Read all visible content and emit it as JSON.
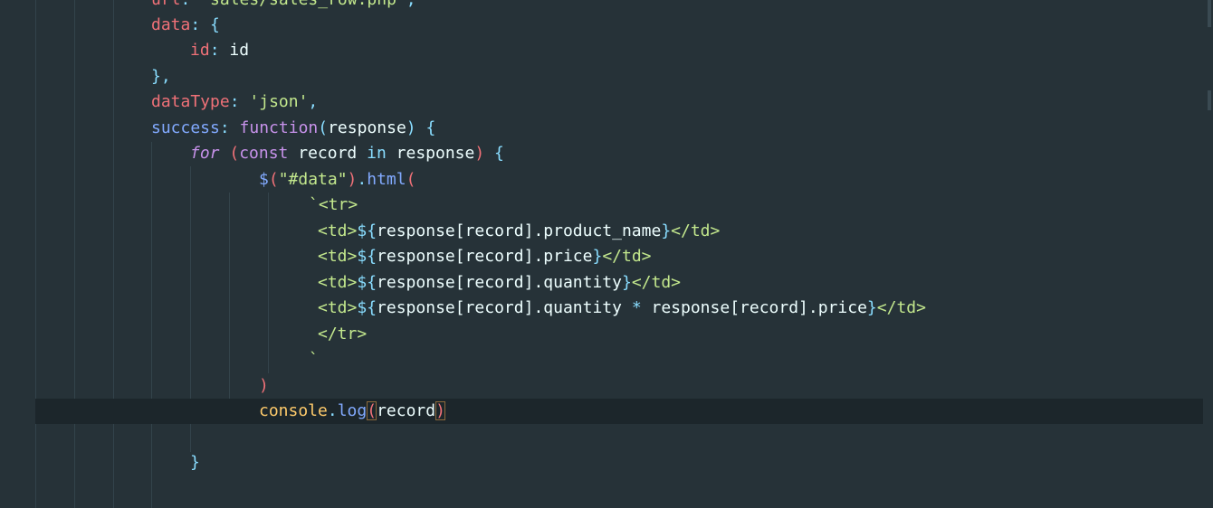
{
  "editor": {
    "language": "javascript",
    "theme_colors": {
      "background": "#263238",
      "active_line": "#1c262b",
      "property": "#f07178",
      "punctuation": "#89ddff",
      "string": "#c3e88d",
      "keyword": "#c792ea",
      "function": "#82aaff",
      "text": "#eeffff",
      "object": "#ffcb6b",
      "bracket_match": "#8d6a3b"
    },
    "lines": {
      "l0": {
        "key": "url",
        "colon": ":",
        "value": "'sales/sales_row.php'",
        "comma": ","
      },
      "l1": {
        "key": "data",
        "colon": ":",
        "brace": "{"
      },
      "l2": {
        "key": "id",
        "colon": ":",
        "value": "id"
      },
      "l3": {
        "text": "},"
      },
      "l4": {
        "key": "dataType",
        "colon": ":",
        "value": "'json'",
        "comma": ","
      },
      "l5": {
        "key": "success",
        "colon": ":",
        "kw": "function",
        "paren_open": "(",
        "param": "response",
        "paren_close": ")",
        "brace": "{"
      },
      "l6": {
        "kw_for": "for",
        "paren_open": "(",
        "kw_const": "const",
        "var": "record",
        "kw_in": "in",
        "target": "response",
        "paren_close": ")",
        "brace": "{"
      },
      "l7": {
        "dollar": "$",
        "paren_open": "(",
        "selector": "\"#data\"",
        "paren_close": ")",
        "dot": ".",
        "method": "html",
        "paren_open2": "("
      },
      "l8": {
        "backtick": "`",
        "tag": "<tr>"
      },
      "l9": {
        "open": "<td>",
        "interp_open": "${",
        "expr": "response[record].product_name",
        "interp_close": "}",
        "close": "</td>"
      },
      "l10": {
        "open": "<td>",
        "interp_open": "${",
        "expr": "response[record].price",
        "interp_close": "}",
        "close": "</td>"
      },
      "l11": {
        "open": "<td>",
        "interp_open": "${",
        "expr": "response[record].quantity",
        "interp_close": "}",
        "close": "</td>"
      },
      "l12": {
        "open": "<td>",
        "interp_open": "${",
        "expr_a": "response[record].quantity",
        "op": " * ",
        "expr_b": "response[record].price",
        "interp_close": "}",
        "close": "</td>"
      },
      "l13": {
        "tag": "</tr>"
      },
      "l14": {
        "backtick": "`"
      },
      "l15": {
        "paren_close": ")"
      },
      "l16": {
        "obj": "console",
        "dot": ".",
        "method": "log",
        "paren_open": "(",
        "arg": "record",
        "paren_close": ")"
      },
      "l17": {
        "brace": "}"
      }
    }
  }
}
